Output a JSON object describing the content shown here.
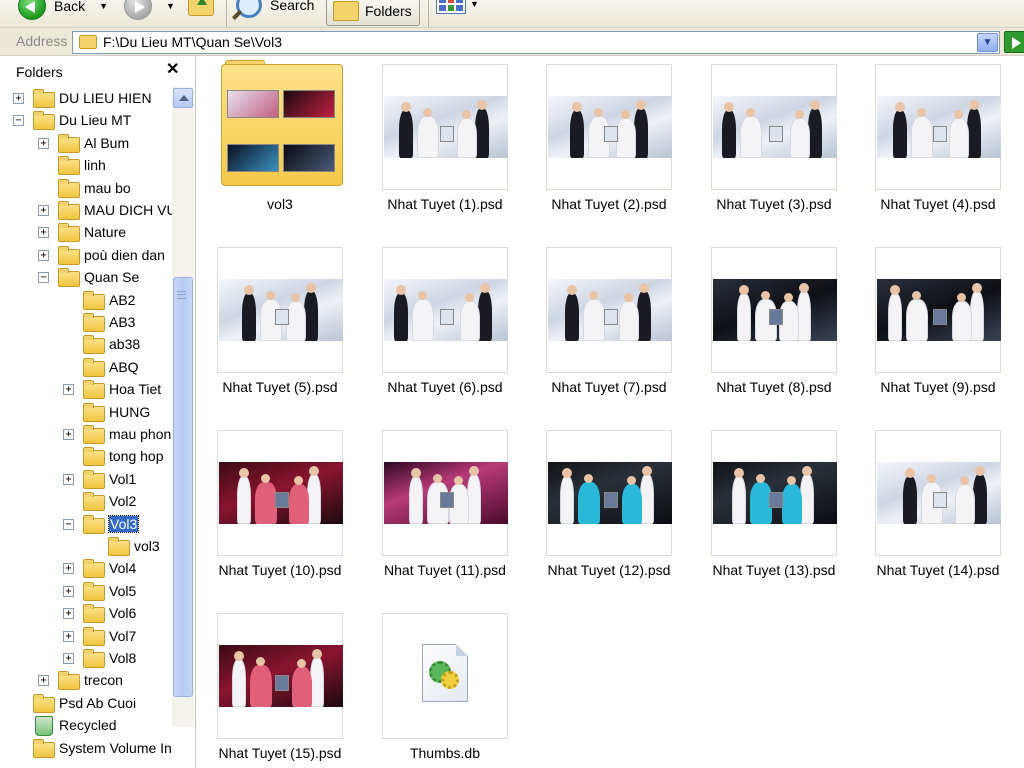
{
  "toolbar": {
    "back_label": "Back",
    "search_label": "Search",
    "folders_label": "Folders"
  },
  "address": {
    "label": "Address",
    "path": "F:\\Du Lieu MT\\Quan Se\\Vol3"
  },
  "folders_pane": {
    "title": "Folders",
    "close": "✕",
    "items": [
      {
        "label": "DU LIEU HIEN",
        "expander": "+"
      },
      {
        "label": "Du Lieu MT",
        "expander": "−"
      },
      {
        "label": "Al Bum",
        "expander": "+"
      },
      {
        "label": "linh",
        "expander": ""
      },
      {
        "label": "mau bo",
        "expander": ""
      },
      {
        "label": "MAU DICH VU",
        "expander": "+"
      },
      {
        "label": "Nature",
        "expander": "+"
      },
      {
        "label": "poù dien dan",
        "expander": "+"
      },
      {
        "label": "Quan Se",
        "expander": "−"
      },
      {
        "label": "AB2",
        "expander": ""
      },
      {
        "label": "AB3",
        "expander": ""
      },
      {
        "label": "ab38",
        "expander": ""
      },
      {
        "label": "ABQ",
        "expander": ""
      },
      {
        "label": "Hoa Tiet",
        "expander": "+"
      },
      {
        "label": "HUNG",
        "expander": ""
      },
      {
        "label": "mau phon",
        "expander": "+"
      },
      {
        "label": "tong hop",
        "expander": ""
      },
      {
        "label": "Vol1",
        "expander": "+"
      },
      {
        "label": "Vol2",
        "expander": ""
      },
      {
        "label": "Vol3",
        "expander": "−"
      },
      {
        "label": "vol3",
        "expander": ""
      },
      {
        "label": "Vol4",
        "expander": "+"
      },
      {
        "label": "Vol5",
        "expander": "+"
      },
      {
        "label": "Vol6",
        "expander": "+"
      },
      {
        "label": "Vol7",
        "expander": "+"
      },
      {
        "label": "Vol8",
        "expander": "+"
      },
      {
        "label": "trecon",
        "expander": "+"
      },
      {
        "label": "Psd Ab Cuoi",
        "expander": ""
      },
      {
        "label": "Recycled",
        "expander": ""
      },
      {
        "label": "System Volume In",
        "expander": ""
      }
    ]
  },
  "files": [
    {
      "name": "vol3",
      "kind": "folder"
    },
    {
      "name": "Nhat Tuyet (1).psd",
      "kind": "psd"
    },
    {
      "name": "Nhat Tuyet (2).psd",
      "kind": "psd"
    },
    {
      "name": "Nhat Tuyet (3).psd",
      "kind": "psd"
    },
    {
      "name": "Nhat Tuyet (4).psd",
      "kind": "psd"
    },
    {
      "name": "Nhat Tuyet (5).psd",
      "kind": "psd"
    },
    {
      "name": "Nhat Tuyet (6).psd",
      "kind": "psd"
    },
    {
      "name": "Nhat Tuyet (7).psd",
      "kind": "psd"
    },
    {
      "name": "Nhat Tuyet (8).psd",
      "kind": "psd"
    },
    {
      "name": "Nhat Tuyet (9).psd",
      "kind": "psd"
    },
    {
      "name": "Nhat Tuyet (10).psd",
      "kind": "psd"
    },
    {
      "name": "Nhat Tuyet (11).psd",
      "kind": "psd"
    },
    {
      "name": "Nhat Tuyet (12).psd",
      "kind": "psd"
    },
    {
      "name": "Nhat Tuyet (13).psd",
      "kind": "psd"
    },
    {
      "name": "Nhat Tuyet (14).psd",
      "kind": "psd"
    },
    {
      "name": "Nhat Tuyet (15).psd",
      "kind": "psd"
    },
    {
      "name": "Thumbs.db",
      "kind": "db"
    }
  ],
  "colors": {
    "selection": "#316ac5",
    "folder": "#f3d36b",
    "toolbar_bg": "#ece9d8"
  }
}
